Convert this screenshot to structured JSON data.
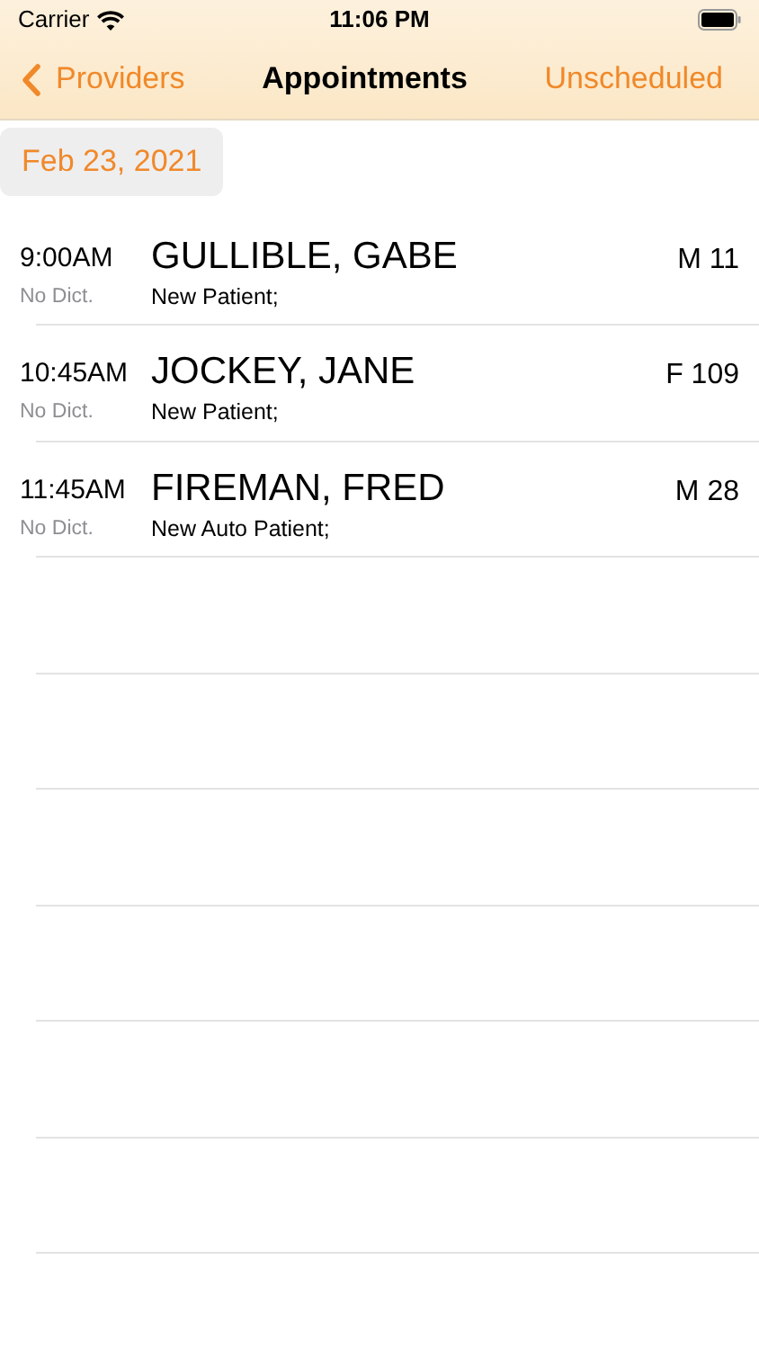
{
  "status_bar": {
    "carrier": "Carrier",
    "time": "11:06 PM"
  },
  "nav": {
    "back": "Providers",
    "title": "Appointments",
    "action": "Unscheduled"
  },
  "date_button": "Feb 23, 2021",
  "appointments": [
    {
      "time": "9:00AM",
      "dictation": "No Dict.",
      "patient": "GULLIBLE, GABE",
      "sex_age": "M 11",
      "visit": "New Patient;"
    },
    {
      "time": "10:45AM",
      "dictation": "No Dict.",
      "patient": "JOCKEY, JANE",
      "sex_age": "F 109",
      "visit": "New Patient;"
    },
    {
      "time": "11:45AM",
      "dictation": "No Dict.",
      "patient": "FIREMAN, FRED",
      "sex_age": "M 28",
      "visit": "New Auto Patient;"
    }
  ]
}
